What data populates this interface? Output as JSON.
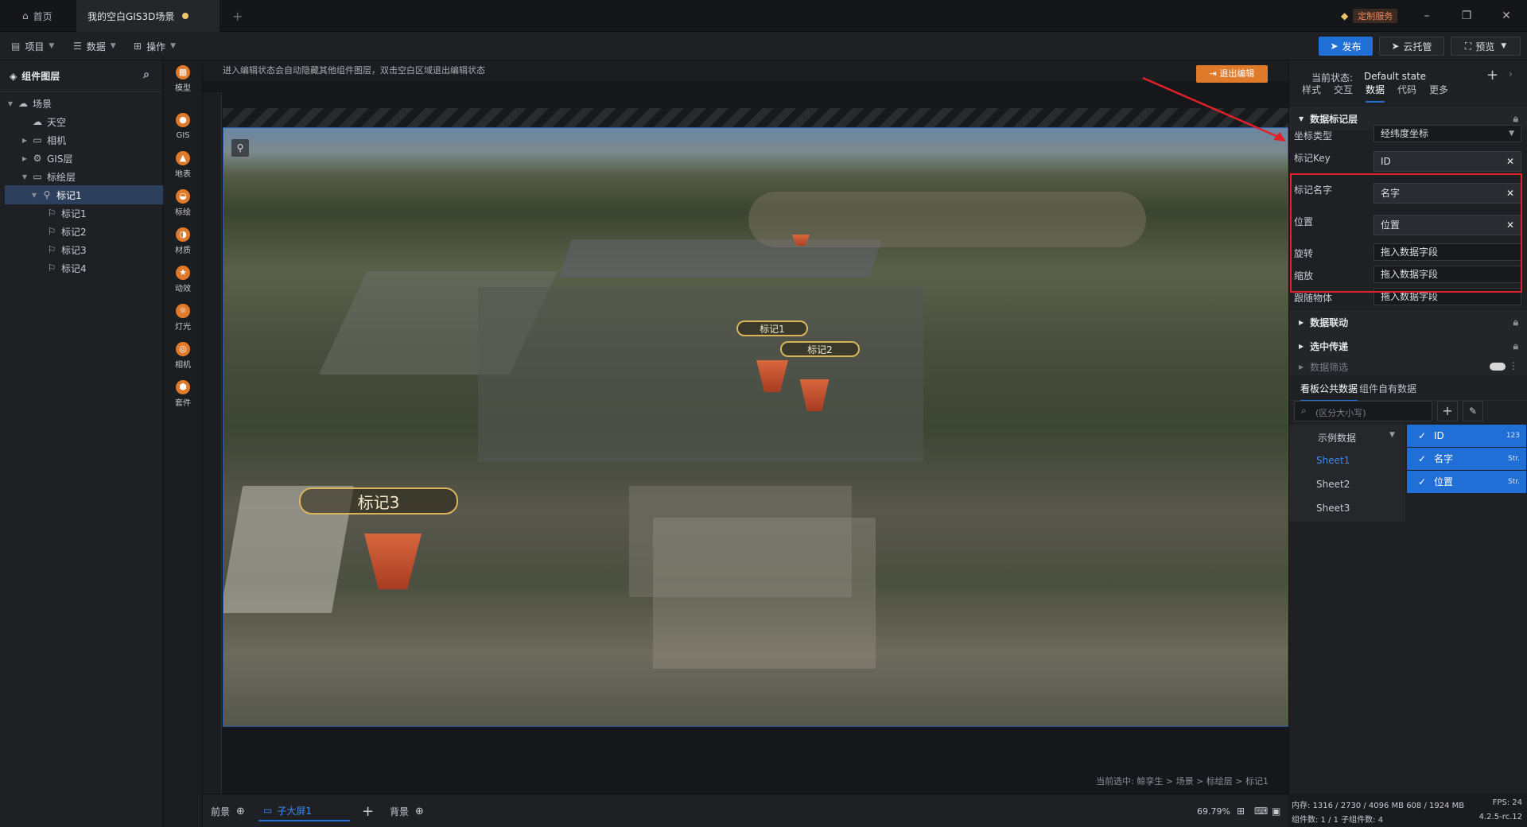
{
  "titlebar": {
    "tabs": [
      {
        "label": "首页",
        "icon": "home-icon"
      },
      {
        "label": "我的空白GIS3D场景",
        "unsaved": true
      }
    ],
    "custom_service": "定制服务"
  },
  "menubar": {
    "items": [
      "项目",
      "数据",
      "操作"
    ],
    "publish": "发布",
    "cloud": "云托管",
    "preview": "预览"
  },
  "layers": {
    "title": "组件图层",
    "tree": [
      {
        "label": "场景",
        "level": 0,
        "icon": "scene-icon",
        "expanded": true
      },
      {
        "label": "天空",
        "level": 1,
        "icon": "sky-icon"
      },
      {
        "label": "相机",
        "level": 1,
        "icon": "folder-icon",
        "collapsed": true
      },
      {
        "label": "GIS层",
        "level": 1,
        "icon": "gis-icon",
        "collapsed": true
      },
      {
        "label": "标绘层",
        "level": 1,
        "icon": "folder-icon",
        "expanded": true
      },
      {
        "label": "标记1",
        "level": 2,
        "icon": "marker-group-icon",
        "selected": true
      },
      {
        "label": "标记1",
        "level": 3,
        "icon": "marker-icon"
      },
      {
        "label": "标记2",
        "level": 3,
        "icon": "marker-icon"
      },
      {
        "label": "标记3",
        "level": 3,
        "icon": "marker-icon"
      },
      {
        "label": "标记4",
        "level": 3,
        "icon": "marker-icon"
      }
    ]
  },
  "tools": [
    "模型",
    "GIS",
    "地表",
    "标绘",
    "材质",
    "动效",
    "灯光",
    "相机",
    "套件"
  ],
  "canvas": {
    "notice": "进入编辑状态会自动隐藏其他组件图层，双击空白区域退出编辑状态",
    "exit_edit": "退出编辑",
    "markers": [
      "标记1",
      "标记2",
      "标记3"
    ],
    "breadcrumb": "当前选中: 鲸孪生 > 场景 > 标绘层 > 标记1"
  },
  "bottombar": {
    "front": "前景",
    "screen": "子大屏1",
    "back": "背景",
    "zoom": "69.79%"
  },
  "rightpanel": {
    "state_label": "当前状态:",
    "state_value": "Default state",
    "tabs": [
      "样式",
      "交互",
      "数据",
      "代码",
      "更多"
    ],
    "active_tab": "数据",
    "section_markers": "数据标记层",
    "coord_type_label": "坐标类型",
    "coord_type_value": "经纬度坐标",
    "fields": [
      {
        "label": "标记Key",
        "value": "ID"
      },
      {
        "label": "标记名字",
        "value": "名字"
      },
      {
        "label": "位置",
        "value": "位置"
      }
    ],
    "empty_fields": [
      {
        "label": "旋转",
        "value": "拖入数据字段"
      },
      {
        "label": "缩放",
        "value": "拖入数据字段"
      },
      {
        "label": "跟随物体",
        "value": "拖入数据字段"
      }
    ],
    "section_link": "数据联动",
    "section_select": "选中传递",
    "section_filter": "数据筛选",
    "data_tabs": [
      "看板公共数据",
      "组件自有数据"
    ],
    "search_placeholder": "(区分大小写)",
    "dataset": "示例数据",
    "sheets": [
      "Sheet1",
      "Sheet2",
      "Sheet3"
    ],
    "data_fields": [
      {
        "name": "ID",
        "type": "123"
      },
      {
        "name": "名字",
        "type": "Str."
      },
      {
        "name": "位置",
        "type": "Str."
      }
    ]
  },
  "status": {
    "memory": "内存: 1316 / 2730 / 4096 MB  608 / 1924 MB",
    "fps": "FPS: 24",
    "components": "组件数: 1 / 1  子组件数: 4",
    "version": "4.2.5-rc.12"
  }
}
